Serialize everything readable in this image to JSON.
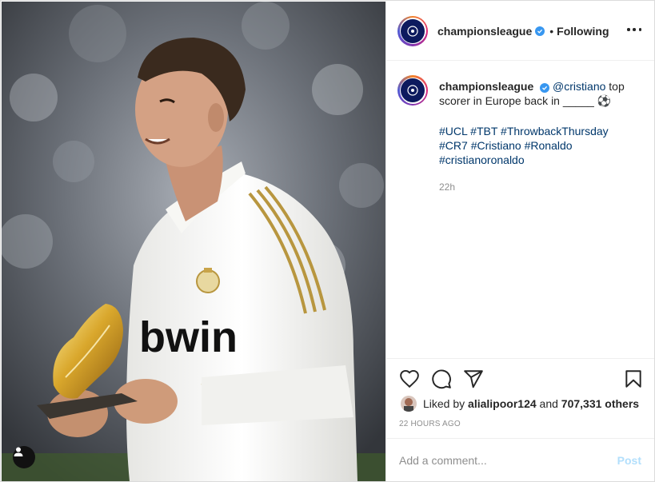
{
  "post": {
    "photo_icon": "user-tag-icon"
  },
  "header": {
    "username": "championsleague",
    "separator": "•",
    "follow_label": "Following",
    "more_icon": "more-options-icon"
  },
  "caption": {
    "username": "championsleague",
    "mention": "@cristiano",
    "text": " top scorer in Europe back in _____ ⚽",
    "hashtags": [
      "#UCL",
      "#TBT",
      "#ThrowbackThursday",
      "#CR7",
      "#Cristiano",
      "#Ronaldo",
      "#cristianoronaldo"
    ],
    "time": "22h"
  },
  "actions": {
    "like_icon": "heart-icon",
    "comment_icon": "comment-icon",
    "share_icon": "send-icon",
    "save_icon": "bookmark-icon"
  },
  "likes": {
    "prefix": "Liked by ",
    "user": "alialipoor124",
    "middle": " and ",
    "count": "707,331 others"
  },
  "timestamp": "22 HOURS AGO",
  "comment": {
    "placeholder": "Add a comment...",
    "post_label": "Post"
  },
  "colors": {
    "link": "#00376b",
    "verified": "#3897f0",
    "post_disabled": "#b2dffc"
  }
}
